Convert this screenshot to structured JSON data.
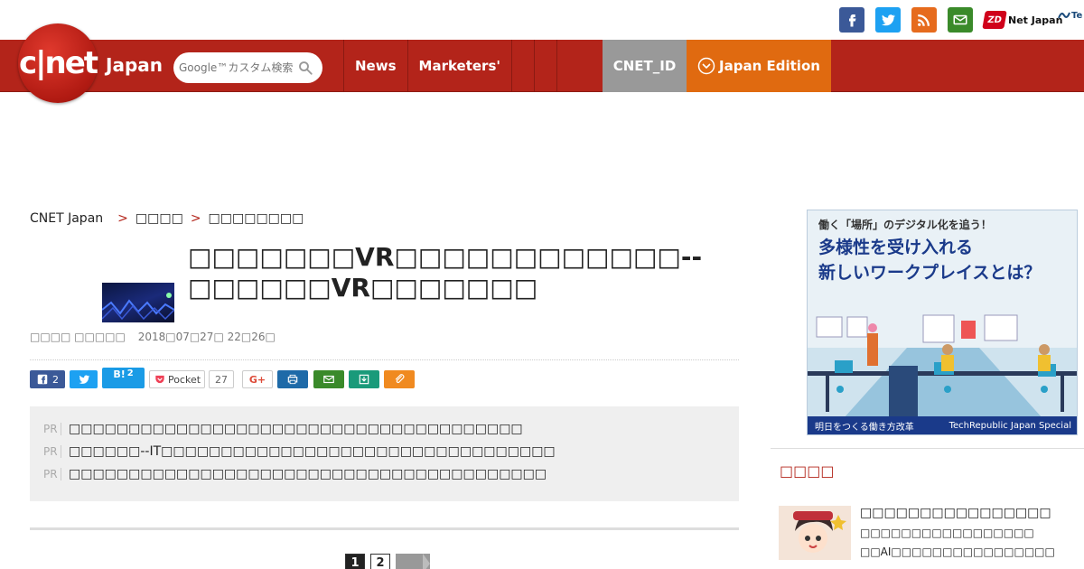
{
  "header": {
    "logo_text": "c|net",
    "logo_suffix": "Japan",
    "search_placeholder": "Google™カスタム検索",
    "zdnet_badge": "ZD",
    "zdnet_label": "Net Japan",
    "techrep_label": "Te",
    "nav": [
      {
        "label": "News"
      },
      {
        "label": "Marketers'"
      }
    ],
    "cnet_id_label": "CNET_ID",
    "edition_label": "Japan Edition"
  },
  "breadcrumb": [
    "CNET Japan",
    "□□□□",
    "□□□□□□□□"
  ],
  "breadcrumb_sep": ">",
  "article": {
    "title": "□□□□□□□VR□□□□□□□□□□□□--□□□□□□VR□□□□□□□",
    "author": "□□□□ □□□□□",
    "date": "2018□07□27□ 22□26□"
  },
  "share": {
    "fb_count": "2",
    "hatena_label": "B!",
    "hatena_count": "2",
    "pocket_label": "Pocket",
    "pocket_count": "27",
    "gplus_label": "G+"
  },
  "pr": {
    "tag": "PR",
    "items": [
      "□□□□□□□□□□□□□□□□□□□□□□□□□□□□□□□□□□□□□□",
      "□□□□□□--IT□□□□□□□□□□□□□□□□□□□□□□□□□□□□□□□□□",
      "□□□□□□□□□□□□□□□□□□□□□□□□□□□□□□□□□□□□□□□□"
    ]
  },
  "pager": {
    "page1": "1",
    "page2": "2"
  },
  "sidebar": {
    "ad": {
      "line1": "働く「場所」のデジタル化を追う！",
      "line2": "多様性を受け入れる",
      "line3": "新しいワークプレイスとは？",
      "footer_left": "明日をつくる働き方改革",
      "footer_right": "TechRepublic Japan Special"
    },
    "section_title": "□□□□",
    "item": {
      "title": "□□□□□□□□□□□□□□□□",
      "sub1": "□□□□□□□□□□□□□□□□□",
      "sub2": "□□AI□□□□□□□□□□□□□□□□"
    }
  },
  "colors": {
    "brand_red": "#b3241a",
    "edition_orange": "#e06a10",
    "cnet_id_gray": "#999999"
  }
}
